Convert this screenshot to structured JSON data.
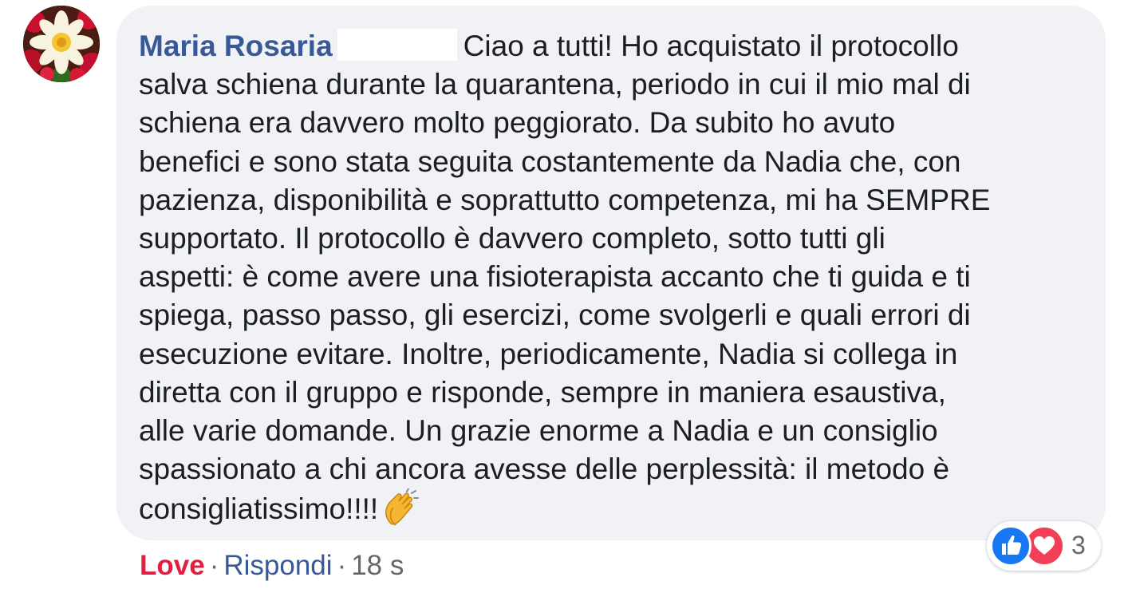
{
  "comment": {
    "author": "Maria Rosaria",
    "lines": [
      "Ciao a tutti! Ho acquistato il protocollo",
      "salva schiena durante la quarantena, periodo in cui il mio mal di",
      "schiena era davvero molto peggiorato. Da subito ho avuto",
      "benefici e sono stata seguita costantemente da Nadia che, con",
      "pazienza, disponibilità e soprattutto competenza, mi ha SEMPRE",
      "supportato. Il protocollo è davvero completo, sotto tutti gli",
      "aspetti: è come avere una fisioterapista accanto che ti guida e ti",
      "spiega, passo passo, gli esercizi, come svolgerli e quali errori di",
      "esecuzione evitare. Inoltre, periodicamente, Nadia si collega in",
      "diretta con il gruppo e risponde, sempre in maniera esaustiva,",
      "alle varie domande. Un grazie enorme a Nadia e un consiglio",
      "spassionato a chi ancora avesse delle perplessità: il metodo è",
      "consigliatissimo!!!!"
    ],
    "emoji": "clapping-hands-icon"
  },
  "actions": {
    "love": "Love",
    "separator": "·",
    "reply": "Rispondi",
    "time": "18 s"
  },
  "reactions": {
    "icons": [
      "like-reaction-icon",
      "love-reaction-icon"
    ],
    "count": "3"
  },
  "colors": {
    "bubble": "#f0f2f5",
    "author": "#385898",
    "love": "#e41e3f",
    "like": "#1877f2",
    "heart": "#f33e58"
  }
}
